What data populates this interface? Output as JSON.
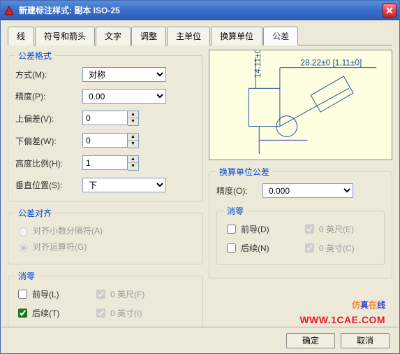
{
  "window": {
    "title": "新建标注样式: 副本 ISO-25"
  },
  "tabs": [
    "线",
    "符号和箭头",
    "文字",
    "调整",
    "主单位",
    "换算单位",
    "公差"
  ],
  "active_tab": 6,
  "tolerance_format": {
    "legend": "公差格式",
    "method_label": "方式(M):",
    "method_value": "对称",
    "precision_label": "精度(P):",
    "precision_value": "0.00",
    "upper_label": "上偏差(V):",
    "upper_value": "0",
    "lower_label": "下偏差(W):",
    "lower_value": "0",
    "height_label": "高度比例(H):",
    "height_value": "1",
    "vpos_label": "垂直位置(S):",
    "vpos_value": "下"
  },
  "alignment": {
    "legend": "公差对齐",
    "opt1": "对齐小数分隔符(A)",
    "opt2": "对齐运算符(G)"
  },
  "zero_suppress_left": {
    "legend": "消零",
    "leading": "前导(L)",
    "trailing": "后续(T)",
    "feet": "0 英尺(F)",
    "inches": "0 英寸(I)"
  },
  "alt_units": {
    "legend": "换算单位公差",
    "precision_label": "精度(O):",
    "precision_value": "0.000",
    "zero_legend": "消零",
    "leading": "前导(D)",
    "trailing": "后续(N)",
    "feet": "0 英尺(E)",
    "inches": "0 英寸(C)"
  },
  "buttons": {
    "ok": "确定",
    "cancel": "取消"
  },
  "watermark": {
    "text": "仿真在线",
    "url": "WWW.1CAE.COM"
  }
}
